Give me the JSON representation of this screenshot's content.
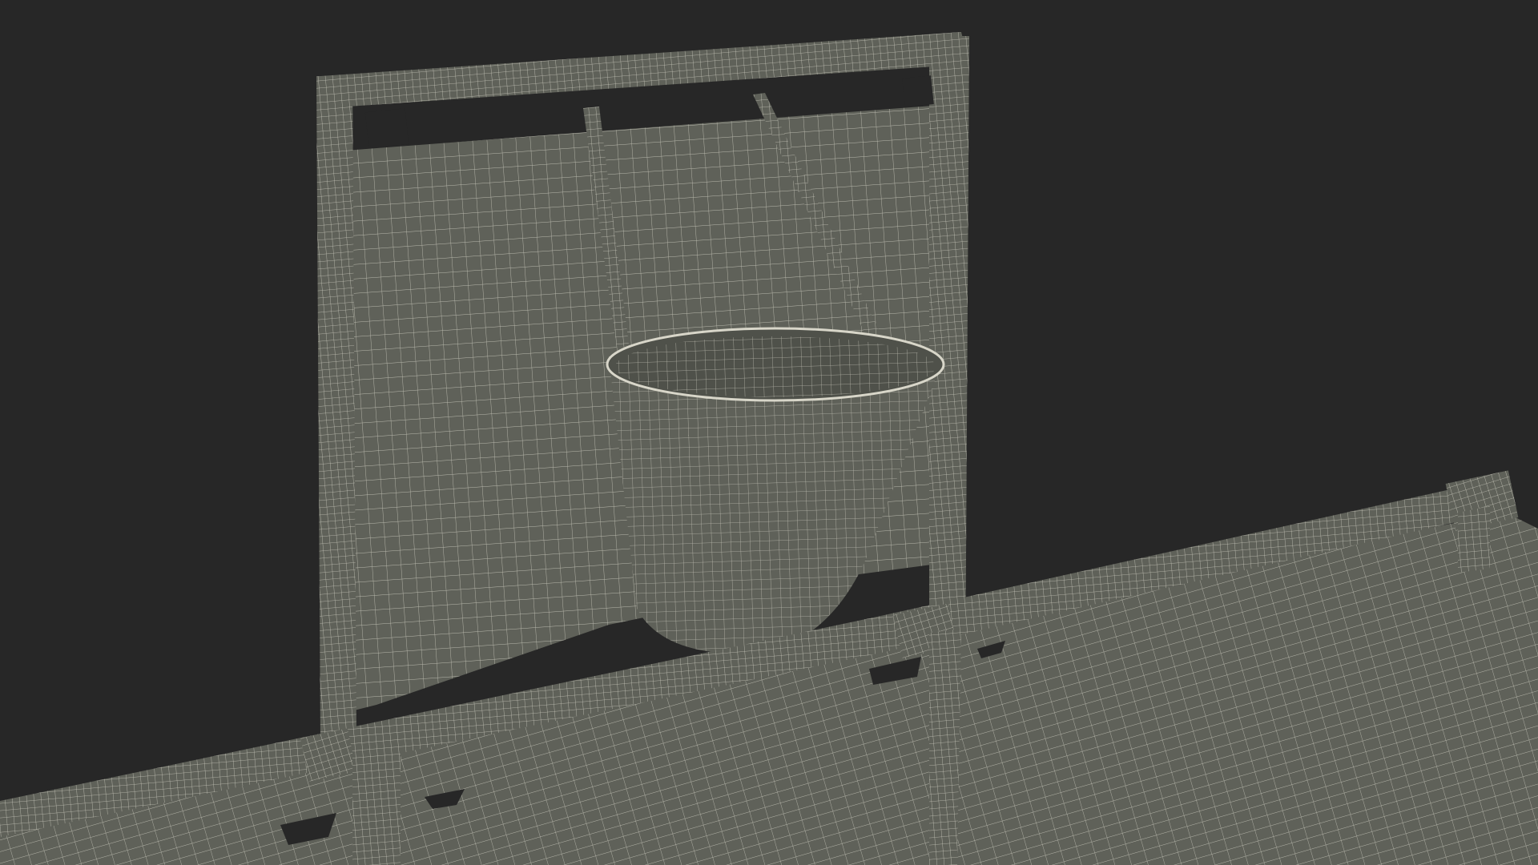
{
  "scene": {
    "subject": "wireframe-render",
    "colors": {
      "background": "#272727",
      "surface": "#5f6159",
      "surface_dark": "#4f514a",
      "wire": "#d8d6c9"
    }
  }
}
